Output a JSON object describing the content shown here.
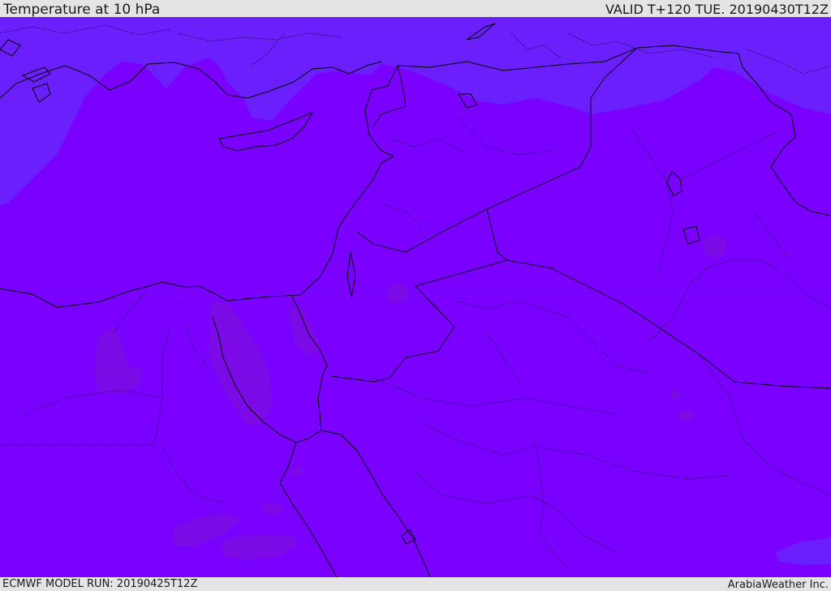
{
  "header": {
    "title": "Temperature at 10 hPa",
    "valid": "VALID T+120 TUE. 20190430T12Z"
  },
  "footer": {
    "model_run": "ECMWF MODEL RUN: 20190425T12Z",
    "credit": "ArabiaWeather Inc."
  },
  "map": {
    "colors": {
      "field_main": "#7a00ff",
      "field_cool": "#6a1ffc",
      "field_warm": "#7c0ae6",
      "coastline": "#000000",
      "border": "#1a0040"
    }
  }
}
